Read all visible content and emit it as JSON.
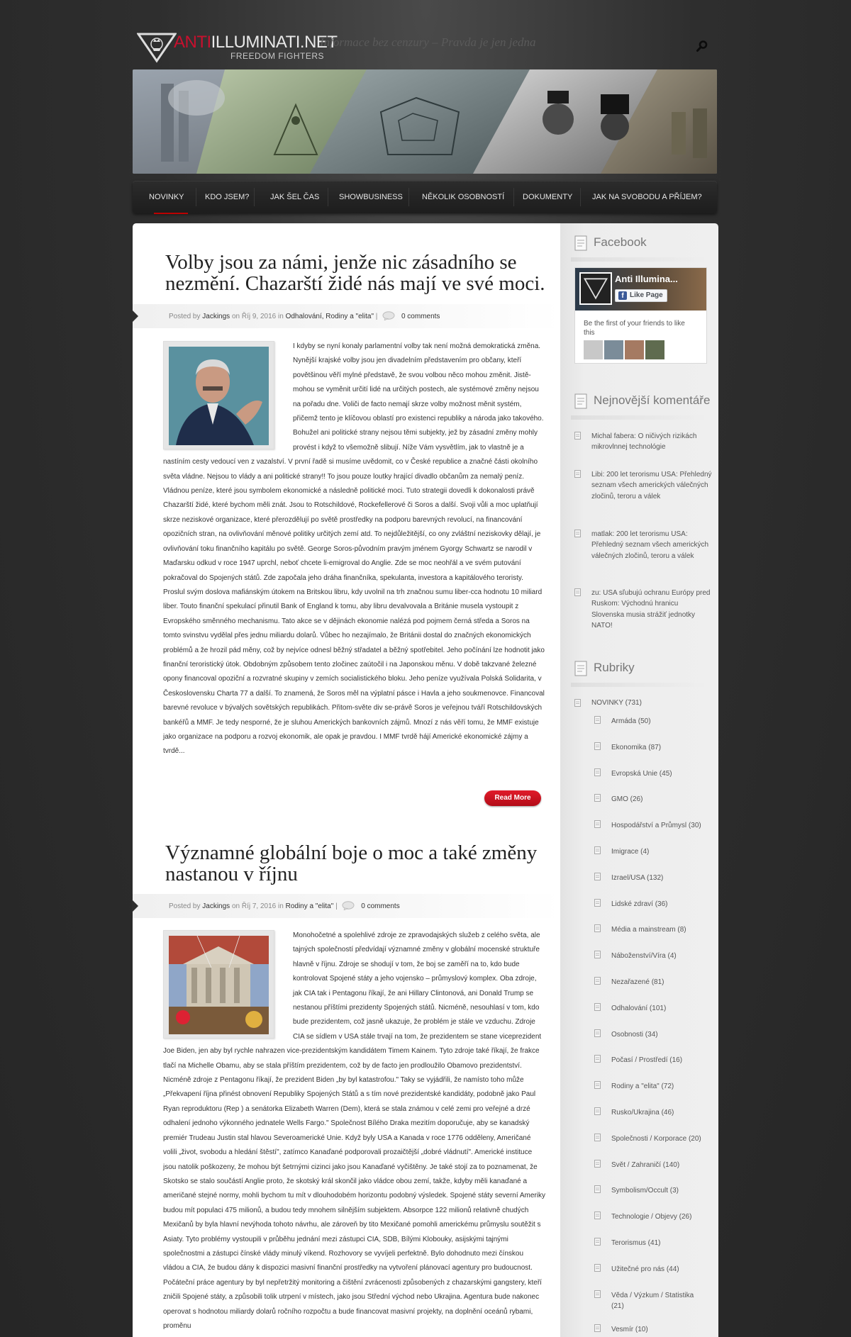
{
  "header": {
    "logo_prefix": "ANTI",
    "logo_main": "ILLUMINATI.NET",
    "logo_sub": "FREEDOM FIGHTERS",
    "tagline": "Informace bez cenzury – Pravda je jen jedna"
  },
  "nav": {
    "items": [
      "Novinky",
      "Kdo jsem?",
      "Jak šel čas",
      "Showbusiness",
      "Několik osobností",
      "Dokumenty",
      "Jak na svobodu a příjem?"
    ]
  },
  "posts": [
    {
      "title": "Volby jsou za námi, jenže nic zásadního se nezmění. Chazarští židé nás mají ve své moci.",
      "meta_posted_by": "Posted by",
      "author": "Jackings",
      "meta_on": "on",
      "date": "Říj 9, 2016",
      "meta_in": "in",
      "categories": "Odhalování, Rodiny a \"elita\"",
      "comments": "0 comments",
      "body": "I kdyby se nyní konaly parlamentní volby tak není možná demokratická změna. Nynější krajské volby jsou jen divadelním představením pro občany, kteří povětšinou věří mylné představě, že svou volbou něco mohou změnit. Jistě-mohou se vyměnit určití lidé na určitých postech, ale systémové změny nejsou na pořadu dne. Voliči de facto nemají skrze volby možnost měnit systém, přičemž tento je klíčovou oblastí pro existenci republiky a národa jako takového. Bohužel ani politické strany nejsou těmi subjekty, jež by zásadní změny mohly provést i když to všemožně slibují. Níže Vám vysvětlím, jak to vlastně je a nastíním cesty vedoucí ven z vazalství. V první řadě si musíme uvědomit, co v České republice a značné části okolního světa vládne. Nejsou to vlády a ani politické strany!! To jsou pouze loutky hrající divadlo občanům za nemalý peníz. Vládnou peníze, které jsou symbolem ekonomické a následně politické moci. Tuto strategii dovedli k dokonalosti právě Chazarští židé, které bychom měli znát. Jsou to Rotschildové, Rockefellerové či Soros a další. Svoji vůli a moc uplatňují skrze neziskové organizace, které přerozdělují po světě prostředky na podporu barevných revolucí, na financování opozičních stran, na ovlivňování měnové politiky určitých zemí atd. To nejdůležitější, co ony zvláštní neziskovky dělají, je ovlivňování toku finančního kapitálu po světě.  George Soros-původním pravým  jménem Gyorgy Schwartz se narodil v Maďarsku odkud v roce 1947 uprchl, neboť chcete li-emigroval do Anglie. Zde se moc neohřál a ve svém putování pokračoval do Spojených států. Zde započala jeho dráha finančníka, spekulanta, investora a kapitálového teroristy. Proslul svým doslova mafiánským útokem na Britskou libru, kdy uvolnil na trh značnou sumu liber-cca hodnotu 10 miliard liber. Touto finanční spekulací přinutil Bank of England k tomu, aby libru devalvovala a Británie musela vystoupit z Evropského směnného mechanismu. Tato akce se v dějinách ekonomie nalézá pod pojmem černá středa a Soros na tomto svinstvu vydělal přes jednu miliardu dolarů. Vůbec ho nezajímalo, že Británii dostal do značných ekonomických problémů a že hrozil pád měny, což by nejvíce odnesl běžný střadatel a běžný spotřebitel. Jeho počínání lze hodnotit jako finanční teroristický útok. Obdobným způsobem tento zločinec zaútočil i na Japonskou měnu.       V době takzvané železné opony financoval opoziční a rozvratné skupiny v zemích socialistického bloku. Jeho peníze využívala Polská Solidarita, v Československu Charta 77 a další. To znamená, že Soros měl na výplatní pásce i Havla a jeho soukmenovce. Financoval barevné revoluce v bývalých sovětských republikách. Přitom-světe div se-právě Soros je veřejnou tváří Rotschildovských bankéřů a MMF. Je tedy nesporné, že je sluhou Amerických bankovních zájmů. Mnozí z nás věří tomu, že MMF existuje jako organizace na podporu a rozvoj ekonomik, ale opak je pravdou. I MMF tvrdě hájí Americké ekonomické zájmy a tvrdě...",
      "read_more": "Read More"
    },
    {
      "title": "Významné globální boje o moc a také změny nastanou v říjnu",
      "meta_posted_by": "Posted by",
      "author": "Jackings",
      "meta_on": "on",
      "date": "Říj 7, 2016",
      "meta_in": "in",
      "categories": "Rodiny a \"elita\"",
      "comments": "0 comments",
      "body": "Monohočetné a spolehlivé zdroje ze zpravodajských služeb z celého světa, ale tajných společností předvídají významné změny v globální mocenské struktuře hlavně v říjnu. Zdroje se shodují v tom, že boj se zaměří na to, kdo bude kontrolovat Spojené státy a jeho vojensko – průmyslový komplex. Oba zdroje, jak CIA tak i Pentagonu říkají, že ani Hillary Clintonová, ani Donald Trump se nestanou příštími prezidenty Spojených států. Nicméně, nesouhlasí v tom, kdo bude prezidentem, což jasně ukazuje, že problém je stále ve vzduchu. Zdroje CIA se sídlem v USA stále trvají na tom, že prezidentem se stane viceprezident Joe Biden, jen aby byl rychle nahrazen vice-prezidentským kandidátem Timem Kainem. Tyto zdroje také říkají, že frakce tlačí na Michelle Obamu, aby se stala příštím prezidentem, což by de facto jen prodloužilo Obamovo prezidentství. Nicméně zdroje z Pentagonu říkají, že prezident Biden „by byl katastrofou.\" Taky se vyjádřili, že namísto toho může „Překvapení října přinést obnovení Republiky Spojených Států a s tím nové prezidentské kandidáty, podobně jako Paul Ryan reproduktoru (Rep ) a senátorka Elizabeth Warren (Dem), která se stala známou v celé zemi pro veřejné a drzé odhalení jednoho výkonného jednatele Wells Fargo.\" Společnost Bílého Draka mezitím doporučuje, aby se kanadský premiér Trudeau Justin stal hlavou Severoamerické Unie. Když byly USA a Kanada v roce 1776 odděleny, Američané volili „život, svobodu a hledání štěstí\", zatímco Kanaďané podporovali prozaičtější „dobré vládnutí\". Americké instituce jsou natolik poškozeny, že mohou být šetrnými cizinci jako jsou Kanaďané vyčištěny. Je také stojí za to poznamenat, že Skotsko se stalo součástí Anglie proto, že skotský král skončil jako vládce obou zemí, takže, kdyby měli kanaďané a američané stejné normy, mohli bychom tu mít v dlouhodobém horizontu podobný výsledek. Spojené státy severní Ameriky budou mít populaci 475 milionů, a budou tedy mnohem silnějším subjektem. Absorpce 122 milionů relativně chudých Mexičanů by byla hlavní nevýhoda tohoto návrhu, ale zároveň by tito Mexičané pomohli americkému průmyslu soutěžit s Asiaty. Tyto problémy vystoupili v průběhu jednání mezi zástupci CIA, SDB, Bílými Klobouky, asijskými tajnými společnostmi a zástupci čínské vlády minulý víkend. Rozhovory se vyvíjeli perfektně. Bylo dohodnuto mezi čínskou vládou a CIA, že budou dány k dispozici masivní finanční prostředky na vytvoření plánovací agentury pro budoucnost. Počáteční práce agentury by byl nepřetržitý monitoring a čištění zvrácenosti způsobených z chazarskými gangstery, kteří zničili Spojené státy, a způsobili tolik utrpení v místech, jako jsou Střední východ nebo Ukrajina. Agentura bude nakonec operovat s hodnotou miliardy dolarů ročního rozpočtu a bude financovat masivní projekty, na doplnění oceánů rybami, proměnu"
    }
  ],
  "sidebar": {
    "facebook": {
      "title": "Facebook",
      "page_name": "Anti Illumina...",
      "like_label": "Like Page",
      "friends_text": "Be the first of your friends to like this"
    },
    "recent_comments": {
      "title": "Nejnovější komentáře",
      "items": [
        "Michal fabera: O ničivých rizikách mikrovlnnej technológie",
        "Libi: 200 let terorismu USA: Přehledný seznam všech amerických válečných zločinů, teroru a válek",
        "matlak: 200 let terorismu USA: Přehledný seznam všech amerických válečných zločinů, teroru a válek",
        "zu: USA sľubujú ochranu Európy pred Ruskom: Východnú hranicu Slovenska musia strážiť jednotky NATO!"
      ]
    },
    "categories": {
      "title": "Rubriky",
      "parent": "NOVINKY (731)",
      "items": [
        "Armáda (50)",
        "Ekonomika (87)",
        "Evropská Unie (45)",
        "GMO (26)",
        "Hospodářství a Průmysl (30)",
        "Imigrace (4)",
        "Izrael/USA (132)",
        "Lidské zdraví (36)",
        "Média a mainstream (8)",
        "Náboženství/Víra (4)",
        "Nezařazené (81)",
        "Odhalování (101)",
        "Osobnosti (34)",
        "Počasí / Prostředí (16)",
        "Rodiny a \"elita\" (72)",
        "Rusko/Ukrajina (46)",
        "Společnosti / Korporace (20)",
        "Svět / Zahraničí (140)",
        "Symbolism/Occult (3)",
        "Technologie / Objevy (26)",
        "Terorismus (41)",
        "Užitečné pro nás (44)",
        "Věda / Výzkum / Statistika (21)",
        "Vesmír (10)"
      ]
    }
  }
}
